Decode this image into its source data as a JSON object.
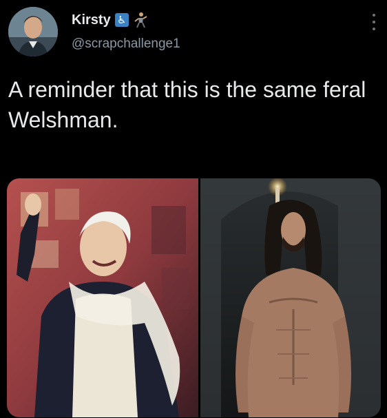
{
  "author": {
    "display_name": "Kirsty",
    "handle": "@scrapchallenge1",
    "badges": [
      "wheelchair-symbol-icon",
      "figure-emoji-icon"
    ]
  },
  "tweet": {
    "text": "A reminder that this is the same feral Welshman."
  },
  "media": {
    "images": [
      {
        "name": "photo-left",
        "description_icon": "man-in-white-suit-feather-boa"
      },
      {
        "name": "photo-right",
        "description_icon": "shirtless-long-haired-man-candle"
      }
    ]
  },
  "colors": {
    "background": "#000000",
    "text_primary": "#e7e9ea",
    "text_secondary": "#8b98a5",
    "badge_blue": "#3b82c4"
  }
}
